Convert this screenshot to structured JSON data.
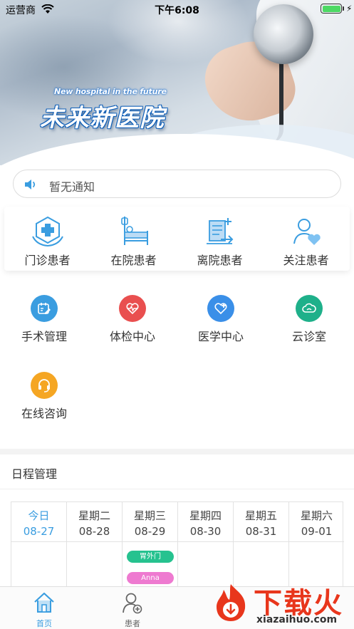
{
  "status_bar": {
    "carrier": "运营商",
    "time": "下午6:08",
    "battery_level": 1.0
  },
  "banner": {
    "title_en": "New hospital in the future",
    "title_cn": "未来新医院"
  },
  "notice": {
    "text": "暂无通知"
  },
  "quick_entries": [
    {
      "label": "门诊患者",
      "icon": "clinic-cross-icon"
    },
    {
      "label": "在院患者",
      "icon": "hospital-bed-icon"
    },
    {
      "label": "离院患者",
      "icon": "discharge-document-icon"
    },
    {
      "label": "关注患者",
      "icon": "user-heart-icon"
    }
  ],
  "features": [
    {
      "label": "手术管理",
      "icon": "calendar-edit-icon",
      "color": "#3a9de0"
    },
    {
      "label": "体检中心",
      "icon": "heartbeat-icon",
      "color": "#e94f4f"
    },
    {
      "label": "医学中心",
      "icon": "medical-shield-icon",
      "color": "#3a8fe8"
    },
    {
      "label": "云诊室",
      "icon": "cloud-icon",
      "color": "#1eb08a"
    },
    {
      "label": "在线咨询",
      "icon": "headset-icon",
      "color": "#f5a623"
    }
  ],
  "schedule": {
    "title": "日程管理",
    "days": [
      {
        "weekday": "今日",
        "date": "08-27",
        "today": true
      },
      {
        "weekday": "星期二",
        "date": "08-28"
      },
      {
        "weekday": "星期三",
        "date": "08-29"
      },
      {
        "weekday": "星期四",
        "date": "08-30"
      },
      {
        "weekday": "星期五",
        "date": "08-31"
      },
      {
        "weekday": "星期六",
        "date": "09-01"
      }
    ],
    "events": [
      {
        "day_index": 2,
        "label": "胃外门",
        "color": "#26c28f"
      },
      {
        "day_index": 2,
        "label": "Anna",
        "color": "#ee7ad0"
      }
    ]
  },
  "tabbar": {
    "tabs": [
      {
        "label": "首页",
        "icon": "home-icon",
        "active": true
      },
      {
        "label": "患者",
        "icon": "patient-icon",
        "active": false
      }
    ]
  },
  "watermark": {
    "cn": "下载火",
    "en": "xiazaihuo.com"
  },
  "colors": {
    "accent": "#3a9de0",
    "watermark_red": "#e8361c"
  }
}
